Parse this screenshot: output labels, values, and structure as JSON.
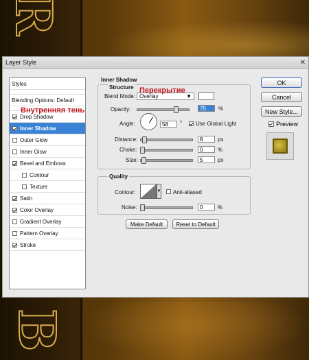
{
  "dialog": {
    "title": "Layer Style",
    "close_glyph": "✕"
  },
  "background_letters": {
    "top": "R",
    "bottom": "B"
  },
  "annotations": {
    "blend_mode_ru": "Перекрытие",
    "inner_shadow_ru": "Внутренняя тень"
  },
  "styles_panel": {
    "header": "Styles",
    "blending_options": "Blending Options: Default",
    "items": [
      {
        "label": "Drop Shadow",
        "checked": true
      },
      {
        "label": "Inner Shadow",
        "checked": true,
        "selected": true
      },
      {
        "label": "Outer Glow",
        "checked": false
      },
      {
        "label": "Inner Glow",
        "checked": false
      },
      {
        "label": "Bevel and Emboss",
        "checked": true
      },
      {
        "label": "Contour",
        "checked": false,
        "indent": true
      },
      {
        "label": "Texture",
        "checked": false,
        "indent": true
      },
      {
        "label": "Satin",
        "checked": true
      },
      {
        "label": "Color Overlay",
        "checked": true
      },
      {
        "label": "Gradient Overlay",
        "checked": false
      },
      {
        "label": "Pattern Overlay",
        "checked": false
      },
      {
        "label": "Stroke",
        "checked": true
      }
    ]
  },
  "inner_shadow": {
    "section_title": "Inner Shadow",
    "structure": {
      "title": "Structure",
      "blend_mode_label": "Blend Mode:",
      "blend_mode_value": "Overlay",
      "blend_color": "#ffffff",
      "opacity_label": "Opacity:",
      "opacity_value": "75",
      "opacity_unit": "%",
      "opacity_level": 0.75,
      "angle_label": "Angle:",
      "angle_value": "58",
      "angle_unit": "°",
      "use_global_light_label": "Use Global Light",
      "use_global_light": true,
      "distance_label": "Distance:",
      "distance_value": "8",
      "distance_unit": "px",
      "choke_label": "Choke:",
      "choke_value": "0",
      "choke_unit": "%",
      "size_label": "Size:",
      "size_value": "5",
      "size_unit": "px"
    },
    "quality": {
      "title": "Quality",
      "contour_label": "Contour:",
      "anti_aliased_label": "Anti-aliased",
      "anti_aliased": false,
      "noise_label": "Noise:",
      "noise_value": "0",
      "noise_unit": "%"
    },
    "make_default_label": "Make Default",
    "reset_to_default_label": "Reset to Default"
  },
  "right_panel": {
    "ok_label": "OK",
    "cancel_label": "Cancel",
    "new_style_label": "New Style...",
    "preview_label": "Preview",
    "preview_checked": true
  }
}
